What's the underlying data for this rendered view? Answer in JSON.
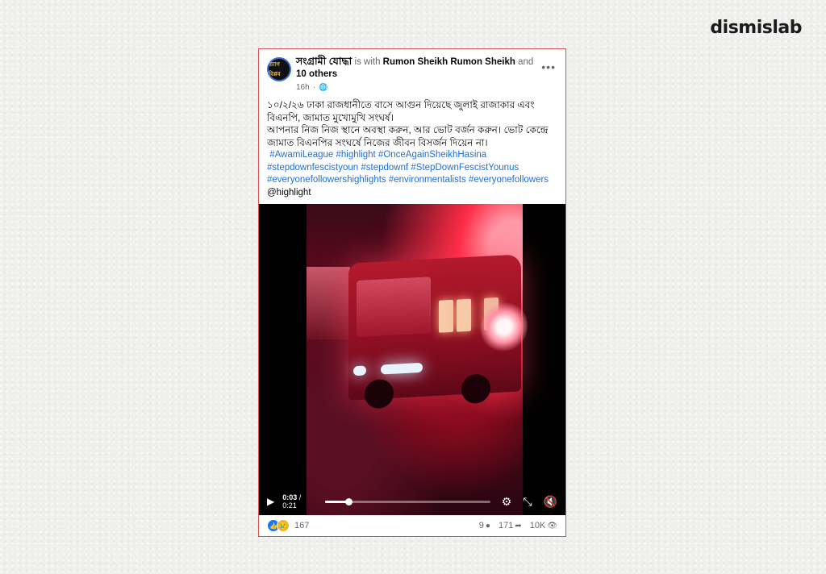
{
  "brand": "dismislab",
  "post": {
    "page_name": "সংগ্রামী যোদ্ধা",
    "with_text": "is with",
    "with_name": "Rumon Sheikh Rumon Sheikh",
    "and_text": "and",
    "others": "10 others",
    "time": "16h",
    "avatar_text": "ত্যাগ বিপ্লব",
    "body_lines": [
      "১০/২/২৬ ঢাকা রাজধানীতে বাসে আগুন দিয়েছে জুলাই রাজাকার এবং বিএনপি, জামাত মুখোমুখি সংঘর্ষ।",
      "আপনার নিজ নিজ স্থানে অবস্থা করুন, আর ভোট বর্জন করুন। ভোট কেন্দ্রে জামাত বিএনপির সংঘর্ষে নিজের জীবন বিসর্জন দিয়েন না।"
    ],
    "hashtags": [
      "#AwamiLeague",
      "#highlight",
      "#OnceAgainSheikhHasina",
      "#stepdownfescistyoun",
      "#stepdownf",
      "#StepDownFescistYounus",
      "#everyonefollowershighlights",
      "#environmentalists",
      "#everyonefollowers"
    ],
    "mention": "@highlight"
  },
  "video": {
    "current_time": "0:03",
    "duration": "0:21",
    "progress": 0.143
  },
  "footer": {
    "reactions_count": "167",
    "comments_count": "9",
    "shares_count": "171",
    "views_count": "10K"
  },
  "icons": {
    "globe": "globe-icon",
    "more": "more-options-icon",
    "play": "play-icon",
    "settings": "gear-icon",
    "fullscreen": "fullscreen-icon",
    "mute": "mute-icon",
    "like": "like-icon",
    "care": "care-icon",
    "comment": "comment-icon",
    "share": "share-icon",
    "views": "eye-icon"
  }
}
